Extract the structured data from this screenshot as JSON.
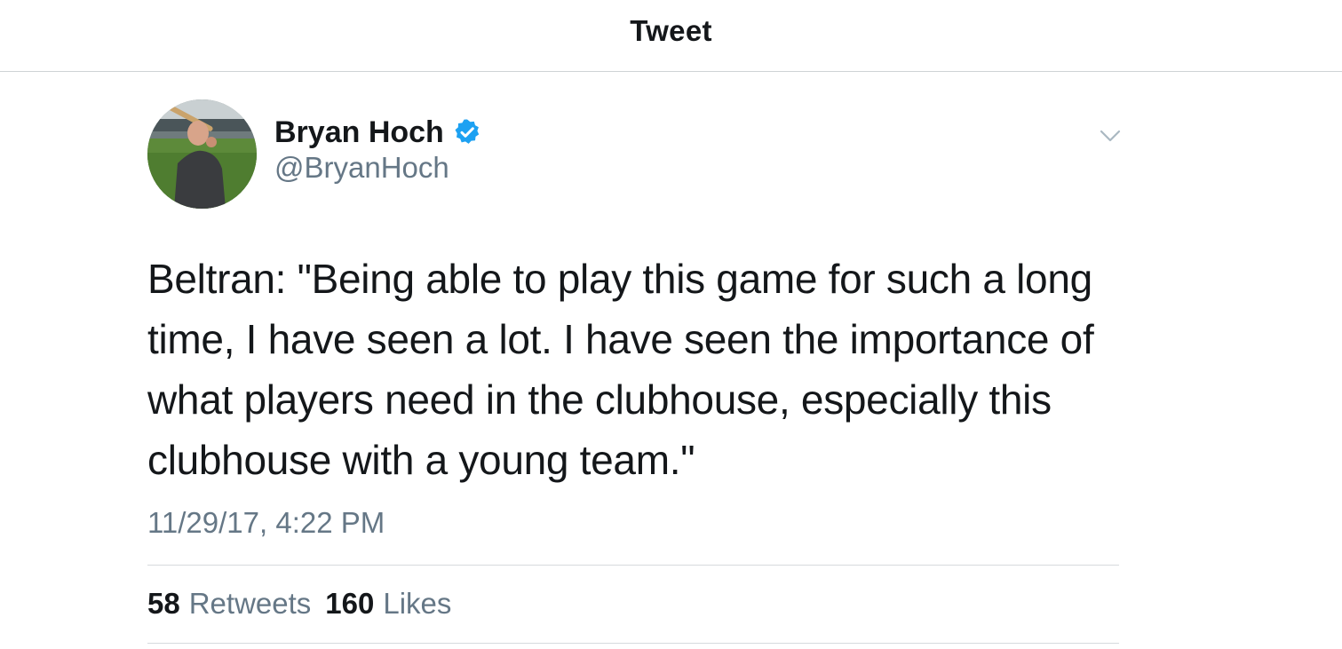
{
  "header": {
    "title": "Tweet"
  },
  "tweet": {
    "avatar_icon": "profile-photo",
    "display_name": "Bryan Hoch",
    "verified_icon": "verified-badge-icon",
    "username": "@BryanHoch",
    "menu_icon": "chevron-down-icon",
    "text": "Beltran: \"Being able to play this game for such a long time, I have seen a lot. I have seen the importance of what players need in the clubhouse, especially this clubhouse with a young team.\"",
    "timestamp": "11/29/17, 4:22 PM",
    "stats": {
      "retweets_count": "58",
      "retweets_label": "Retweets",
      "likes_count": "160",
      "likes_label": "Likes"
    }
  },
  "colors": {
    "text_primary": "#14171a",
    "text_secondary": "#657786",
    "verified_blue": "#1da1f2",
    "divider": "#d6dadd"
  }
}
